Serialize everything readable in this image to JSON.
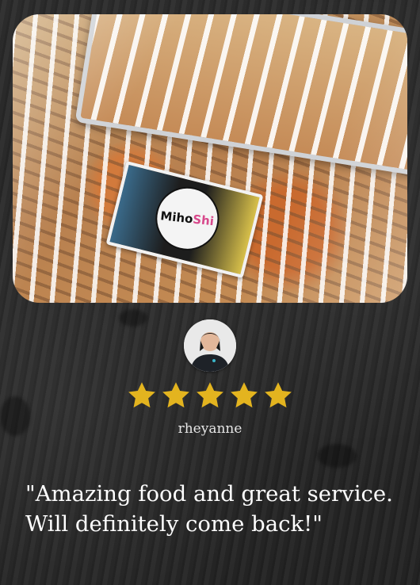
{
  "review": {
    "rating": 5,
    "rating_max": 5,
    "star_color": "#e3b41f",
    "reviewer_name": "rheyanne",
    "quote": "\"Amazing food and great service.\nWill definitely come back!\""
  },
  "photo": {
    "sticker_text_main": "Miho",
    "sticker_text_accent": "Shi"
  }
}
